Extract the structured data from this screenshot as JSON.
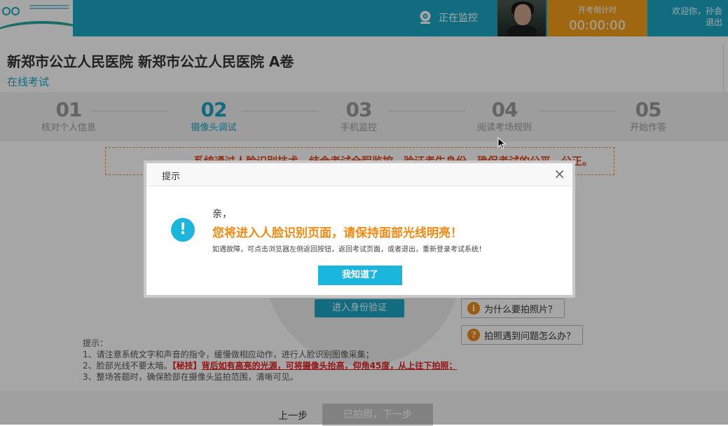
{
  "header": {
    "monitor_text": "正在监控",
    "countdown_label": "开考倒计时",
    "countdown_time": "00:00:00",
    "welcome": "欢迎你，孙会",
    "logout": "退出",
    "accent_color": "#1ba6c4",
    "countdown_color": "#f5a01a"
  },
  "page": {
    "title": "新郑市公立人民医院 新郑市公立人民医院 A卷",
    "subtitle": "在线考试"
  },
  "steps": [
    {
      "num": "01",
      "name": "核对个人信息"
    },
    {
      "num": "02",
      "name": "摄像头调试"
    },
    {
      "num": "03",
      "name": "手机监控"
    },
    {
      "num": "04",
      "name": "阅读考场规则"
    },
    {
      "num": "05",
      "name": "开始作答"
    }
  ],
  "active_step": 2,
  "notice": "系统通过人脸识别技术，结合考试全程监控，验证考生身份，确保考试的公平、公正。",
  "verify_button": "进入身份验证",
  "help": {
    "why_photo": "为什么要拍照片？",
    "photo_problem": "拍照遇到问题怎么办？"
  },
  "tips": {
    "title": "提示：",
    "line1": "1、请注意系统文字和声音的指令，缓慢做相应动作，进行人脸识别图像采集；",
    "line2_prefix": "2、脸部光线不要太暗。",
    "line2_tag": "【秘技】",
    "line2_highlight": "背后如有高亮的光源，可将摄像头抬高，仰角45度，从上往下拍照；",
    "line3": "3、整场答题时，确保脸部在摄像头监拍范围，清晰可见。"
  },
  "bottom": {
    "prev": "上一步",
    "next": "已拍照，下一步"
  },
  "dialog": {
    "title": "提示",
    "close": "×",
    "greeting": "亲，",
    "main": "您将进入人脸识别页面，请保持面部光线明亮！",
    "detail": "如遇故障，可点击浏览器左侧返回按钮，返回考试页面，或者退出，重新登录考试系统！",
    "ok": "我知道了",
    "highlight_color": "#f5890f"
  }
}
